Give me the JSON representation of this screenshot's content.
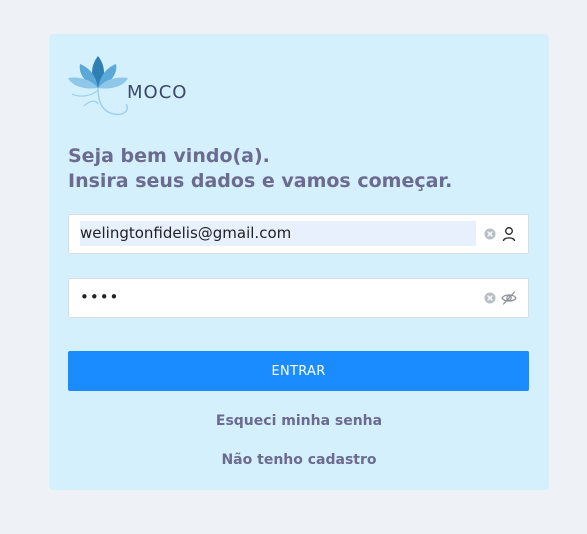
{
  "brand": {
    "name": "MOCO",
    "icon": "lotus-flower-logo"
  },
  "welcome": {
    "line1": "Seja bem vindo(a).",
    "line2": "Insira seus dados e vamos começar."
  },
  "email": {
    "value": "welingtonfidelis@gmail.com",
    "clear_icon": "clear-circle-icon",
    "trailing_icon": "user-icon"
  },
  "password": {
    "masked_value": "••••",
    "clear_icon": "clear-circle-icon",
    "trailing_icon": "eye-off-icon"
  },
  "actions": {
    "submit_label": "ENTRAR",
    "forgot_label": "Esqueci minha senha",
    "register_label": "Não tenho cadastro"
  },
  "colors": {
    "page_bg": "#eef1f6",
    "card_bg": "#d5f0fd",
    "primary": "#1a8cff",
    "heading": "#6b6a8f"
  }
}
